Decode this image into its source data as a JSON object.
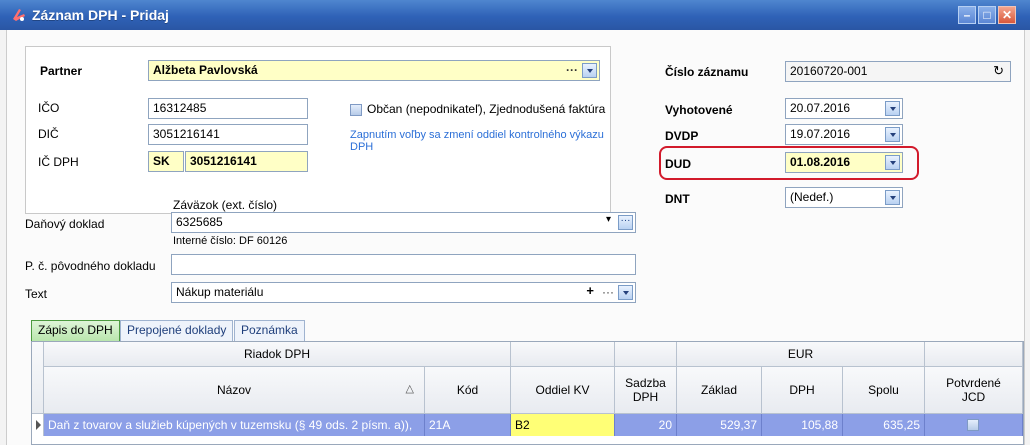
{
  "window": {
    "title": "Záznam DPH - Pridaj"
  },
  "partner": {
    "label": "Partner",
    "value": "Alžbeta Pavlovská"
  },
  "ico": {
    "label": "IČO",
    "value": "16312485"
  },
  "dic": {
    "label": "DIČ",
    "value": "3051216141"
  },
  "icdph": {
    "label": "IČ DPH",
    "prefix": "SK",
    "value": "3051216141"
  },
  "option": {
    "label": "Občan (nepodnikateľ), Zjednodušená faktúra",
    "hint": "Zapnutím voľby sa zmení oddiel kontrolného výkazu DPH"
  },
  "right": {
    "cislo": {
      "label": "Číslo záznamu",
      "value": "20160720-001"
    },
    "vyhotovene": {
      "label": "Vyhotovené",
      "value": "20.07.2016"
    },
    "dvdp": {
      "label": "DVDP",
      "value": "19.07.2016"
    },
    "dud": {
      "label": "DUD",
      "value": "01.08.2016"
    },
    "dnt": {
      "label": "DNT",
      "value": "(Nedef.)"
    }
  },
  "danovy": {
    "label": "Daňový doklad",
    "header": "Záväzok (ext. číslo)",
    "value": "6325685",
    "internal": "Interné číslo: DF 60126"
  },
  "povodny": {
    "label": "P. č. pôvodného dokladu",
    "value": ""
  },
  "text": {
    "label": "Text",
    "value": "Nákup materiálu"
  },
  "tabs": [
    {
      "label": "Zápis do DPH",
      "active": true
    },
    {
      "label": "Prepojené doklady",
      "active": false
    },
    {
      "label": "Poznámka",
      "active": false
    }
  ],
  "grid": {
    "group_headers": {
      "riadok": "Riadok DPH",
      "eur": "EUR"
    },
    "columns": {
      "nazov": "Názov",
      "kod": "Kód",
      "oddiel": "Oddiel KV",
      "sadzba": "Sadzba DPH",
      "zaklad": "Základ",
      "dph": "DPH",
      "spolu": "Spolu",
      "potvrdene": "Potvrdené JCD"
    },
    "row": {
      "nazov": "Daň z tovarov a služieb kúpených v tuzemsku (§ 49 ods. 2 písm. a)),",
      "kod": "21A",
      "oddiel": "B2",
      "sadzba": "20",
      "zaklad": "529,37",
      "dph": "105,88",
      "spolu": "635,25"
    }
  }
}
